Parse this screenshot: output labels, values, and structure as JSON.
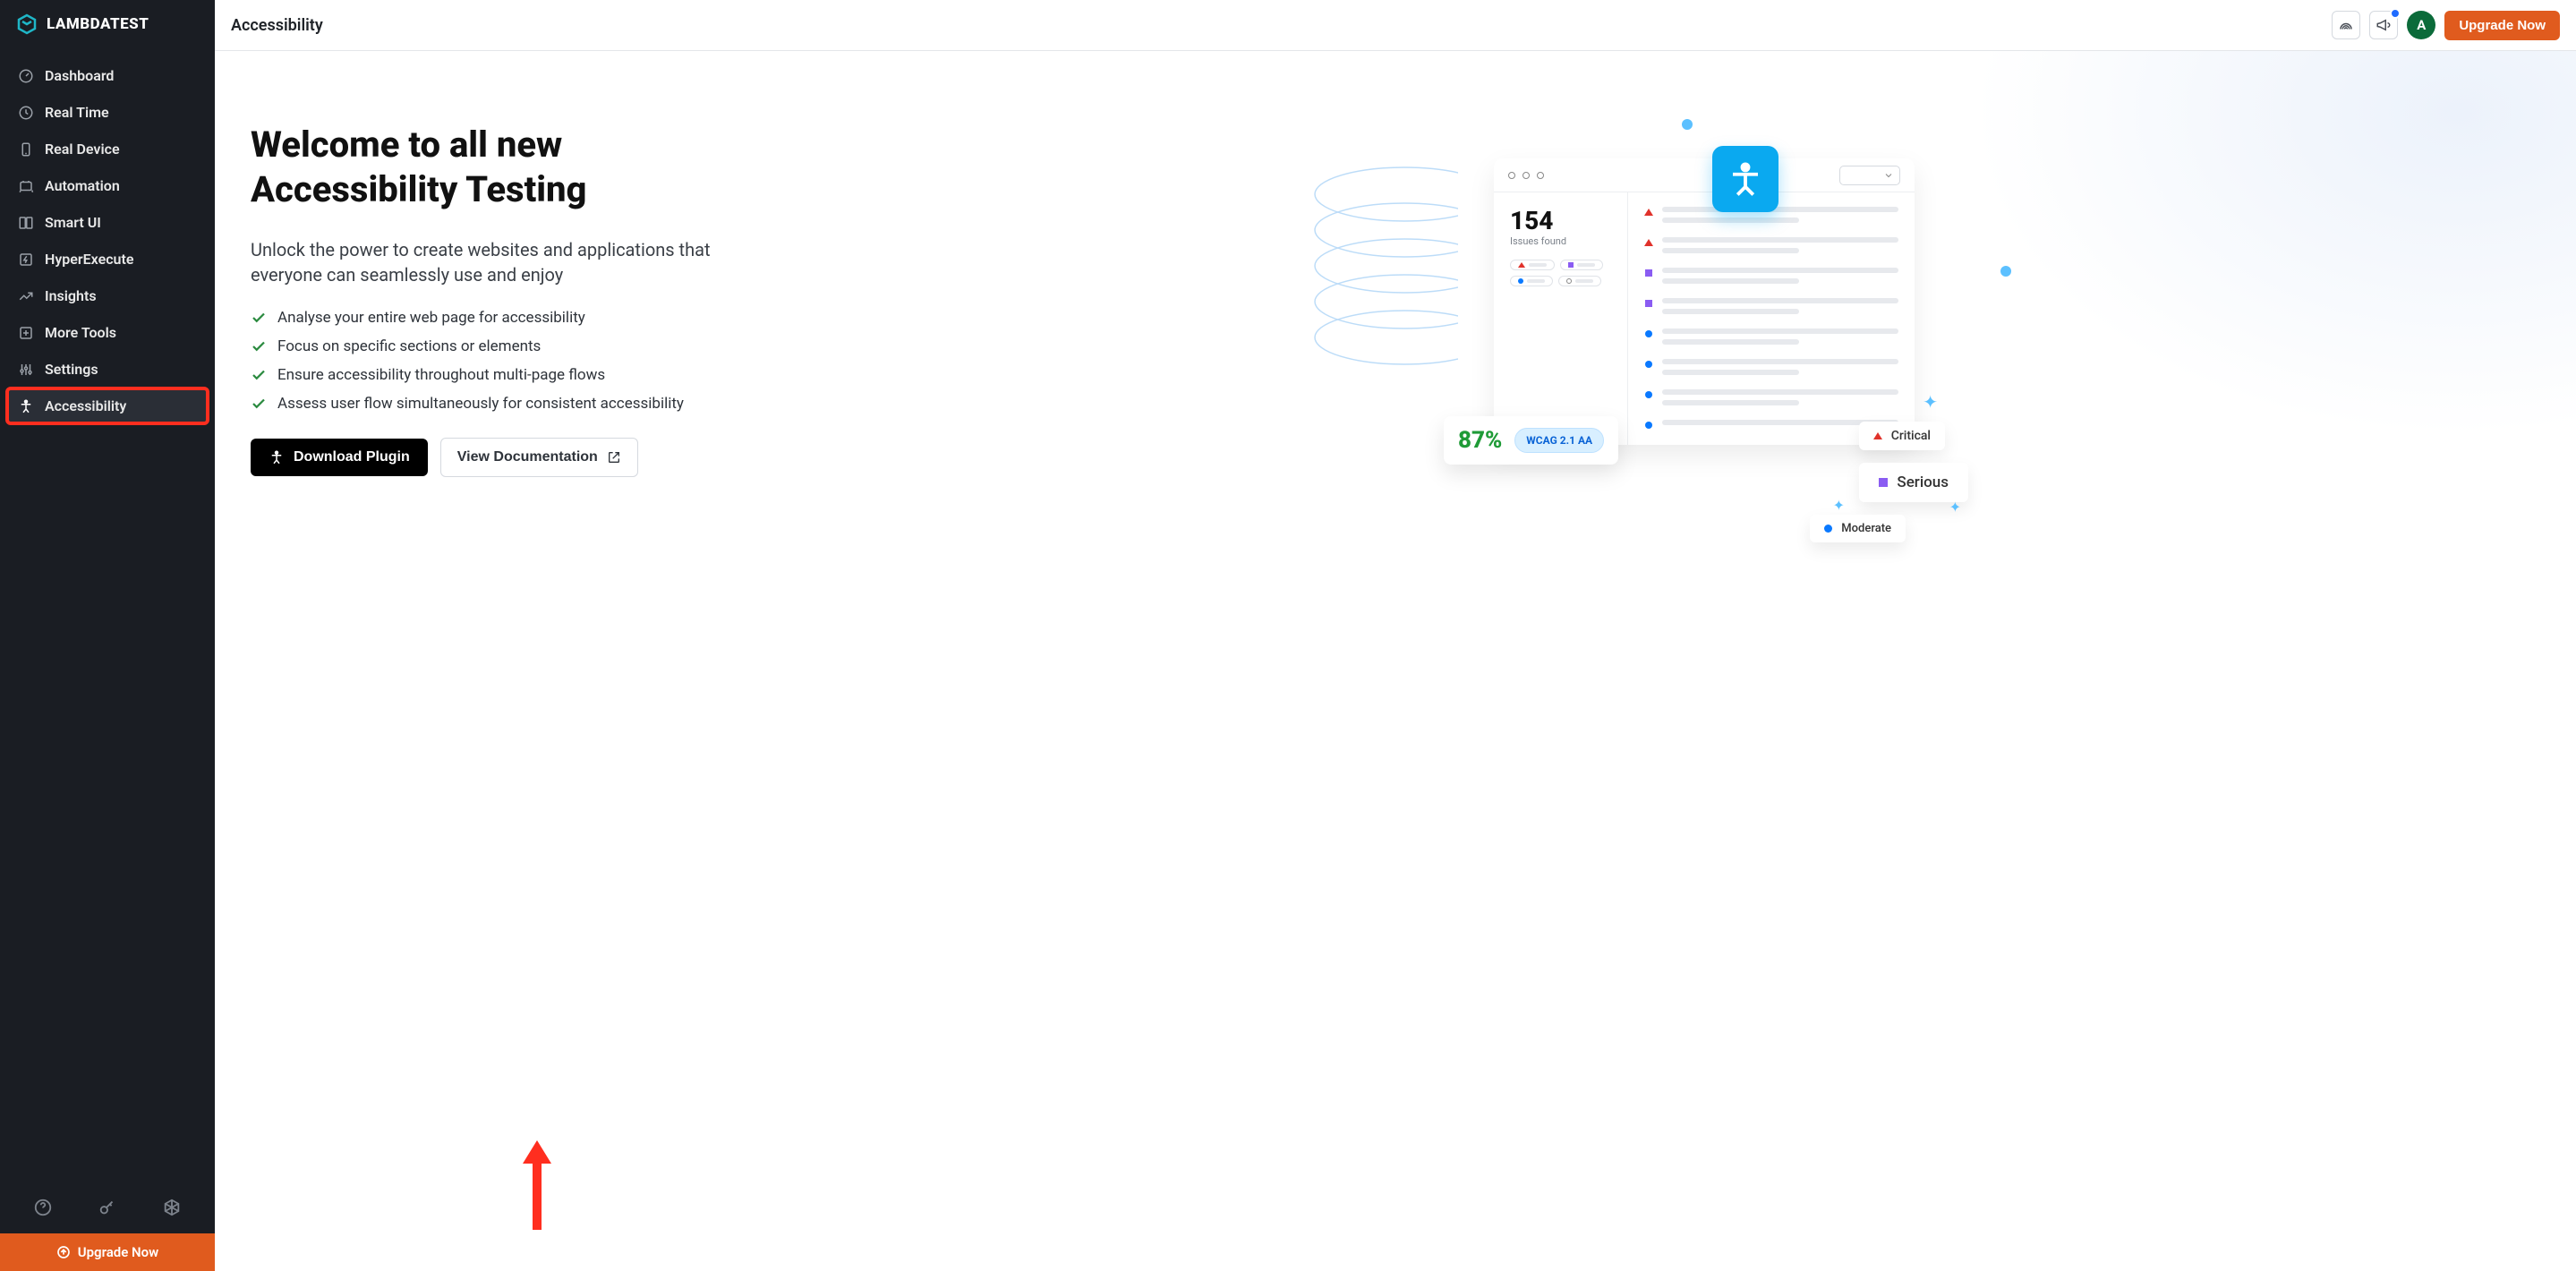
{
  "brand": {
    "name": "LAMBDATEST"
  },
  "sidebar": {
    "items": [
      {
        "label": "Dashboard"
      },
      {
        "label": "Real Time"
      },
      {
        "label": "Real Device"
      },
      {
        "label": "Automation"
      },
      {
        "label": "Smart UI"
      },
      {
        "label": "HyperExecute"
      },
      {
        "label": "Insights"
      },
      {
        "label": "More Tools"
      },
      {
        "label": "Settings"
      },
      {
        "label": "Accessibility"
      }
    ],
    "upgrade": "Upgrade Now"
  },
  "header": {
    "title": "Accessibility",
    "avatar_initial": "A",
    "upgrade": "Upgrade Now"
  },
  "hero": {
    "title": "Welcome to all new Accessibility Testing",
    "subtitle": "Unlock the power to create websites and applications that everyone can seamlessly use and enjoy",
    "features": [
      "Analyse your entire web page for accessibility",
      "Focus on specific sections or elements",
      "Ensure accessibility throughout multi-page flows",
      "Assess user flow simultaneously for consistent accessibility"
    ],
    "primary_cta": "Download Plugin",
    "secondary_cta": "View Documentation"
  },
  "illustration": {
    "issues_value": "154",
    "issues_label": "Issues found",
    "score_pct": "87%",
    "wcag": "WCAG 2.1 AA",
    "severity": {
      "critical": "Critical",
      "serious": "Serious",
      "moderate": "Moderate"
    }
  }
}
